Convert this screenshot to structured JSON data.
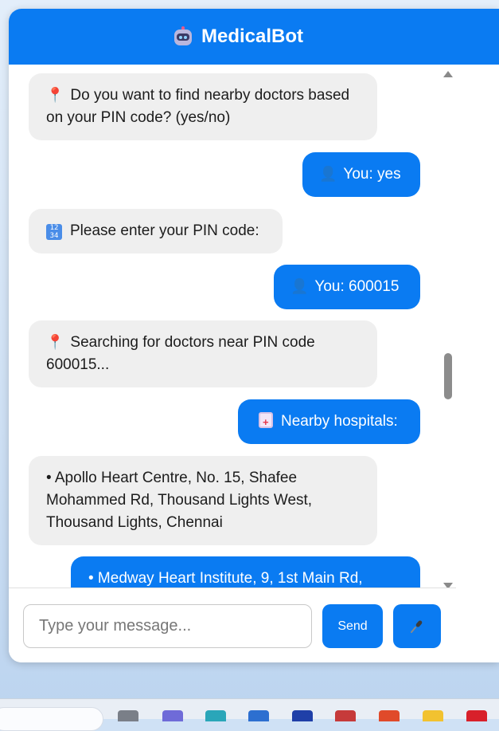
{
  "header": {
    "title": "MedicalBot"
  },
  "messages": [
    {
      "sender": "bot",
      "icon": "round-pushpin-icon",
      "text": "Do you want to find nearby doctors based on your PIN code? (yes/no)"
    },
    {
      "sender": "user",
      "icon": "bust-in-silhouette-icon",
      "text": "You: yes"
    },
    {
      "sender": "bot",
      "icon": "input-numbers-icon",
      "text": "Please enter your PIN code:"
    },
    {
      "sender": "user",
      "icon": "bust-in-silhouette-icon",
      "text": "You: 600015"
    },
    {
      "sender": "bot",
      "icon": "round-pushpin-icon",
      "text": "Searching for doctors near PIN code 600015..."
    },
    {
      "sender": "user",
      "icon": "hospital-icon",
      "text": "Nearby hospitals:"
    },
    {
      "sender": "bot",
      "icon": "",
      "text": "• Apollo Heart Centre, No. 15, Shafee Mohammed Rd, Thousand Lights West, Thousand Lights, Chennai"
    },
    {
      "sender": "user",
      "icon": "",
      "text": "• Medway Heart Institute, 9, 1st Main Rd,"
    }
  ],
  "footer": {
    "input_placeholder": "Type your message...",
    "send_label": "Send",
    "mic_icon": "microphone-icon"
  },
  "colors": {
    "accent": "#0a7bf2",
    "bot_bubble": "#efefef",
    "user_bubble": "#0a7bf2"
  }
}
